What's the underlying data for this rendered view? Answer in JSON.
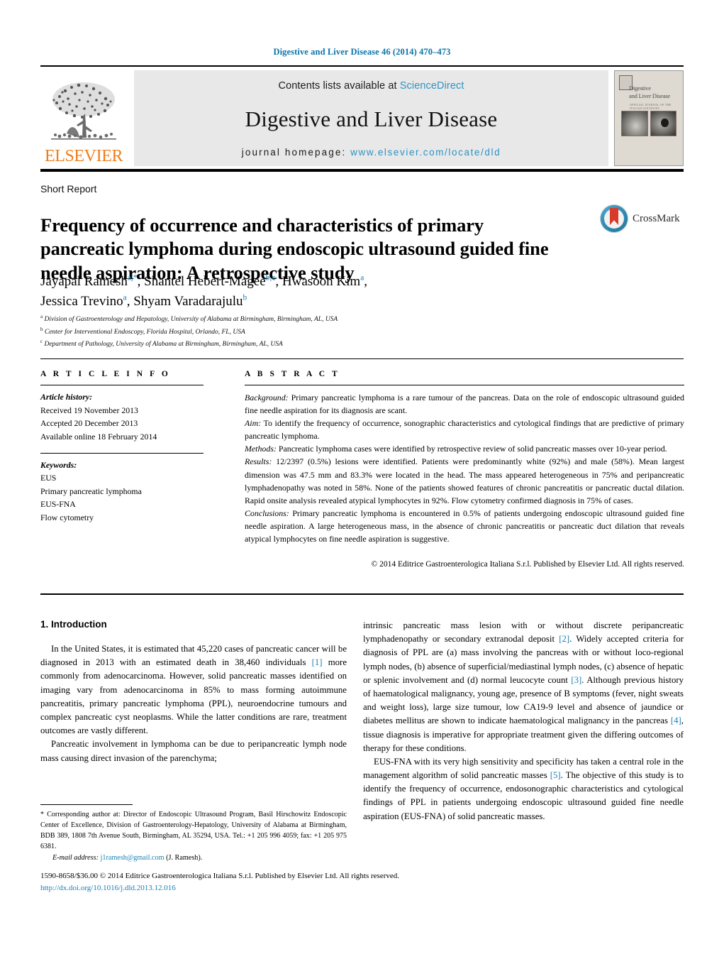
{
  "running_head": "Digestive and Liver Disease 46 (2014) 470–473",
  "masthead": {
    "contents_prefix": "Contents lists available at ",
    "sciencedirect": "ScienceDirect",
    "journal_name": "Digestive and Liver Disease",
    "homepage_prefix": "journal homepage:",
    "homepage_url": "www.elsevier.com/locate/dld",
    "publisher_wordmark": "ELSEVIER",
    "cover": {
      "title_line1": "Digestive",
      "title_line2": "and Liver Disease",
      "subtitle": "OFFICIAL JOURNAL OF THE ITALIAN SOCIETIES"
    },
    "accent_link_color": "#2d93c4",
    "publisher_color": "#ef7d1a"
  },
  "article": {
    "type_label": "Short Report",
    "title": "Frequency of occurrence and characteristics of primary pancreatic lymphoma during endoscopic ultrasound guided fine needle aspiration: A retrospective study",
    "authors": [
      {
        "name": "Jayapal Ramesh",
        "marks": "a,*"
      },
      {
        "name": "Shantel Hebert-Magee",
        "marks": "b,c"
      },
      {
        "name": "Hwasoon Kim",
        "marks": "a"
      },
      {
        "name": "Jessica Trevino",
        "marks": "a"
      },
      {
        "name": "Shyam Varadarajulu",
        "marks": "b"
      }
    ],
    "affiliations": [
      {
        "mark": "a",
        "text": "Division of Gastroenterology and Hepatology, University of Alabama at Birmingham, Birmingham, AL, USA"
      },
      {
        "mark": "b",
        "text": "Center for Interventional Endoscopy, Florida Hospital, Orlando, FL, USA"
      },
      {
        "mark": "c",
        "text": "Department of Pathology, University of Alabama at Birmingham, Birmingham, AL, USA"
      }
    ],
    "crossmark_label": "CrossMark"
  },
  "article_info": {
    "heading": "A R T I C L E    I N F O",
    "history_label": "Article history:",
    "history": [
      "Received 19 November 2013",
      "Accepted 20 December 2013",
      "Available online 18 February 2014"
    ],
    "keywords_label": "Keywords:",
    "keywords": [
      "EUS",
      "Primary pancreatic lymphoma",
      "EUS-FNA",
      "Flow cytometry"
    ]
  },
  "abstract": {
    "heading": "A B S T R A C T",
    "sections": [
      {
        "label": "Background:",
        "text": " Primary pancreatic lymphoma is a rare tumour of the pancreas. Data on the role of endoscopic ultrasound guided fine needle aspiration for its diagnosis are scant."
      },
      {
        "label": "Aim:",
        "text": " To identify the frequency of occurrence, sonographic characteristics and cytological findings that are predictive of primary pancreatic lymphoma."
      },
      {
        "label": "Methods:",
        "text": " Pancreatic lymphoma cases were identified by retrospective review of solid pancreatic masses over 10-year period."
      },
      {
        "label": "Results:",
        "text": " 12/2397 (0.5%) lesions were identified. Patients were predominantly white (92%) and male (58%). Mean largest dimension was 47.5 mm and 83.3% were located in the head. The mass appeared heterogeneous in 75% and peripancreatic lymphadenopathy was noted in 58%. None of the patients showed features of chronic pancreatitis or pancreatic ductal dilation. Rapid onsite analysis revealed atypical lymphocytes in 92%. Flow cytometry confirmed diagnosis in 75% of cases."
      },
      {
        "label": "Conclusions:",
        "text": " Primary pancreatic lymphoma is encountered in 0.5% of patients undergoing endoscopic ultrasound guided fine needle aspiration. A large heterogeneous mass, in the absence of chronic pancreatitis or pancreatic duct dilation that reveals atypical lymphocytes on fine needle aspiration is suggestive."
      }
    ],
    "copyright": "© 2014 Editrice Gastroenterologica Italiana S.r.l. Published by Elsevier Ltd. All rights reserved."
  },
  "body": {
    "section_title": "1.  Introduction",
    "left_paragraphs": [
      "In the United States, it is estimated that 45,220 cases of pancreatic cancer will be diagnosed in 2013 with an estimated death in 38,460 individuals [1] more commonly from adenocarcinoma. However, solid pancreatic masses identified on imaging vary from adenocarcinoma in 85% to mass forming autoimmune pancreatitis, primary pancreatic lymphoma (PPL), neuroendocrine tumours and complex pancreatic cyst neoplasms. While the latter conditions are rare, treatment outcomes are vastly different.",
      "Pancreatic involvement in lymphoma can be due to peripancreatic lymph node mass causing direct invasion of the parenchyma;"
    ],
    "right_paragraphs": [
      "intrinsic pancreatic mass lesion with or without discrete peripancreatic lymphadenopathy or secondary extranodal deposit [2]. Widely accepted criteria for diagnosis of PPL are (a) mass involving the pancreas with or without loco-regional lymph nodes, (b) absence of superficial/mediastinal lymph nodes, (c) absence of hepatic or splenic involvement and (d) normal leucocyte count [3]. Although previous history of haematological malignancy, young age, presence of B symptoms (fever, night sweats and weight loss), large size tumour, low CA19-9 level and absence of jaundice or diabetes mellitus are shown to indicate haematological malignancy in the pancreas [4], tissue diagnosis is imperative for appropriate treatment given the differing outcomes of therapy for these conditions.",
      "EUS-FNA with its very high sensitivity and specificity has taken a central role in the management algorithm of solid pancreatic masses [5]. The objective of this study is to identify the frequency of occurrence, endosonographic characteristics and cytological findings of PPL in patients undergoing endoscopic ultrasound guided fine needle aspiration (EUS-FNA) of solid pancreatic masses."
    ]
  },
  "footnote": {
    "corresponding": "* Corresponding author at: Director of Endoscopic Ultrasound Program, Basil Hirschowitz Endoscopic Center of Excellence, Division of Gastroenterology-Hepatology, University of Alabama at Birmingham, BDB 389, 1808 7th Avenue South, Birmingham, AL 35294, USA. Tel.: +1 205 996 4059; fax: +1 205 975 6381.",
    "email_label": "E-mail address:",
    "email": "j1ramesh@gmail.com",
    "email_owner": "(J. Ramesh)."
  },
  "imprint": {
    "line1": "1590-8658/$36.00 © 2014 Editrice Gastroenterologica Italiana S.r.l. Published by Elsevier Ltd. All rights reserved.",
    "doi": "http://dx.doi.org/10.1016/j.dld.2013.12.016"
  }
}
